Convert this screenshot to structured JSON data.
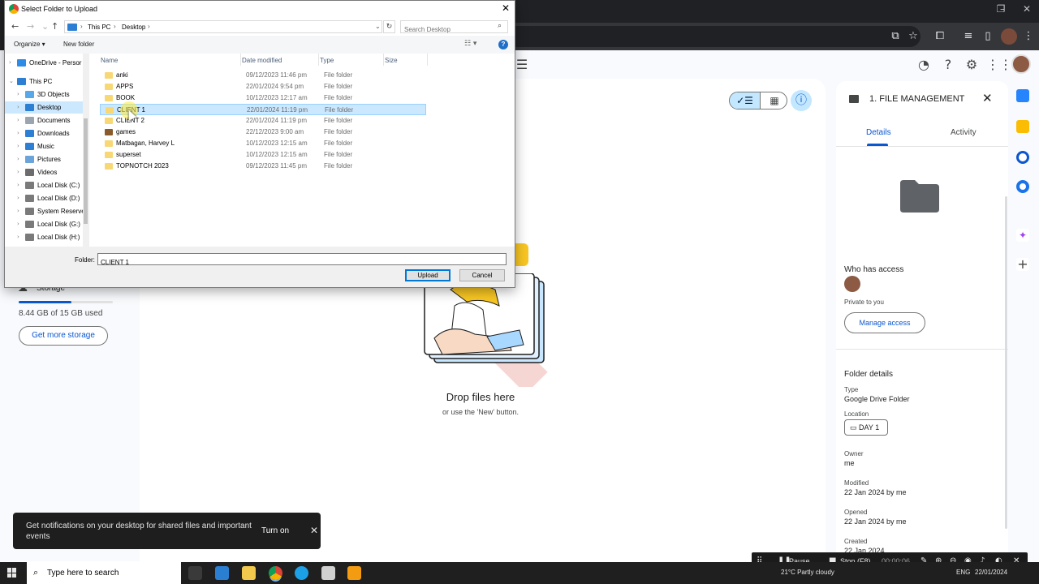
{
  "browser": {
    "window_controls": [
      "–",
      "❐",
      "✕"
    ]
  },
  "drive": {
    "storage": {
      "label": "Storage",
      "used_text": "8.44 GB of 15 GB used",
      "used_fraction": 0.56,
      "button": "Get more storage"
    },
    "drop": {
      "title": "Drop files here",
      "subtitle": "or use the 'New' button."
    },
    "details": {
      "title": "1. FILE MANAGEMENT",
      "tabs": [
        "Details",
        "Activity"
      ],
      "who_has_access": "Who has access",
      "private": "Private to you",
      "manage_access": "Manage access",
      "folder_details": "Folder details",
      "type_label": "Type",
      "type_value": "Google Drive Folder",
      "location_label": "Location",
      "location_value": "DAY 1",
      "owner_label": "Owner",
      "owner_value": "me",
      "modified_label": "Modified",
      "modified_value": "22 Jan 2024 by me",
      "opened_label": "Opened",
      "opened_value": "22 Jan 2024 by me",
      "created_label": "Created",
      "created_value": "22 Jan 2024"
    },
    "toast": {
      "text": "Get notifications on your desktop for shared files and important events",
      "button": "Turn on"
    }
  },
  "dialog": {
    "title": "Select Folder to Upload",
    "path": [
      "This PC",
      "Desktop"
    ],
    "search_placeholder": "Search Desktop",
    "organize": "Organize ▾",
    "new_folder": "New folder",
    "columns": [
      "Name",
      "Date modified",
      "Type",
      "Size"
    ],
    "nav_items": [
      {
        "label": "OneDrive - Persor",
        "color": "#2e8be6"
      },
      {
        "label": "This PC",
        "color": "#2d7fd3"
      },
      {
        "label": "3D Objects",
        "color": "#56a8e8"
      },
      {
        "label": "Desktop",
        "color": "#2d7fd3"
      },
      {
        "label": "Documents",
        "color": "#9aa5b1"
      },
      {
        "label": "Downloads",
        "color": "#2d7fd3"
      },
      {
        "label": "Music",
        "color": "#2d7fd3"
      },
      {
        "label": "Pictures",
        "color": "#6aa4d8"
      },
      {
        "label": "Videos",
        "color": "#6c6c6c"
      },
      {
        "label": "Local Disk (C:)",
        "color": "#7a7a7a"
      },
      {
        "label": "Local Disk (D:)",
        "color": "#7a7a7a"
      },
      {
        "label": "System Reservec",
        "color": "#7a7a7a"
      },
      {
        "label": "Local Disk (G:)",
        "color": "#7a7a7a"
      },
      {
        "label": "Local Disk (H:)",
        "color": "#7a7a7a"
      }
    ],
    "files": [
      {
        "name": "anki",
        "date": "09/12/2023 11:46 pm",
        "type": "File folder"
      },
      {
        "name": "APPS",
        "date": "22/01/2024 9:54 pm",
        "type": "File folder"
      },
      {
        "name": "BOOK",
        "date": "10/12/2023 12:17 am",
        "type": "File folder"
      },
      {
        "name": "CLIENT 1",
        "date": "22/01/2024 11:19 pm",
        "type": "File folder"
      },
      {
        "name": "CLIENT 2",
        "date": "22/01/2024 11:19 pm",
        "type": "File folder"
      },
      {
        "name": "games",
        "date": "22/12/2023 9:00 am",
        "type": "File folder"
      },
      {
        "name": "Matbagan, Harvey L",
        "date": "10/12/2023 12:15 am",
        "type": "File folder"
      },
      {
        "name": "superset",
        "date": "10/12/2023 12:15 am",
        "type": "File folder"
      },
      {
        "name": "TOPNOTCH 2023",
        "date": "09/12/2023 11:45 pm",
        "type": "File folder"
      }
    ],
    "folder_label": "Folder:",
    "folder_value": "CLIENT 1",
    "upload": "Upload",
    "cancel": "Cancel"
  },
  "recorder": {
    "pause": "Pause",
    "stop": "Stop (F8)",
    "time": "00:00:06"
  },
  "taskbar": {
    "search": "Type here to search",
    "weather": "21°C  Partly cloudy",
    "lang": "ENG",
    "date": "22/01/2024"
  }
}
